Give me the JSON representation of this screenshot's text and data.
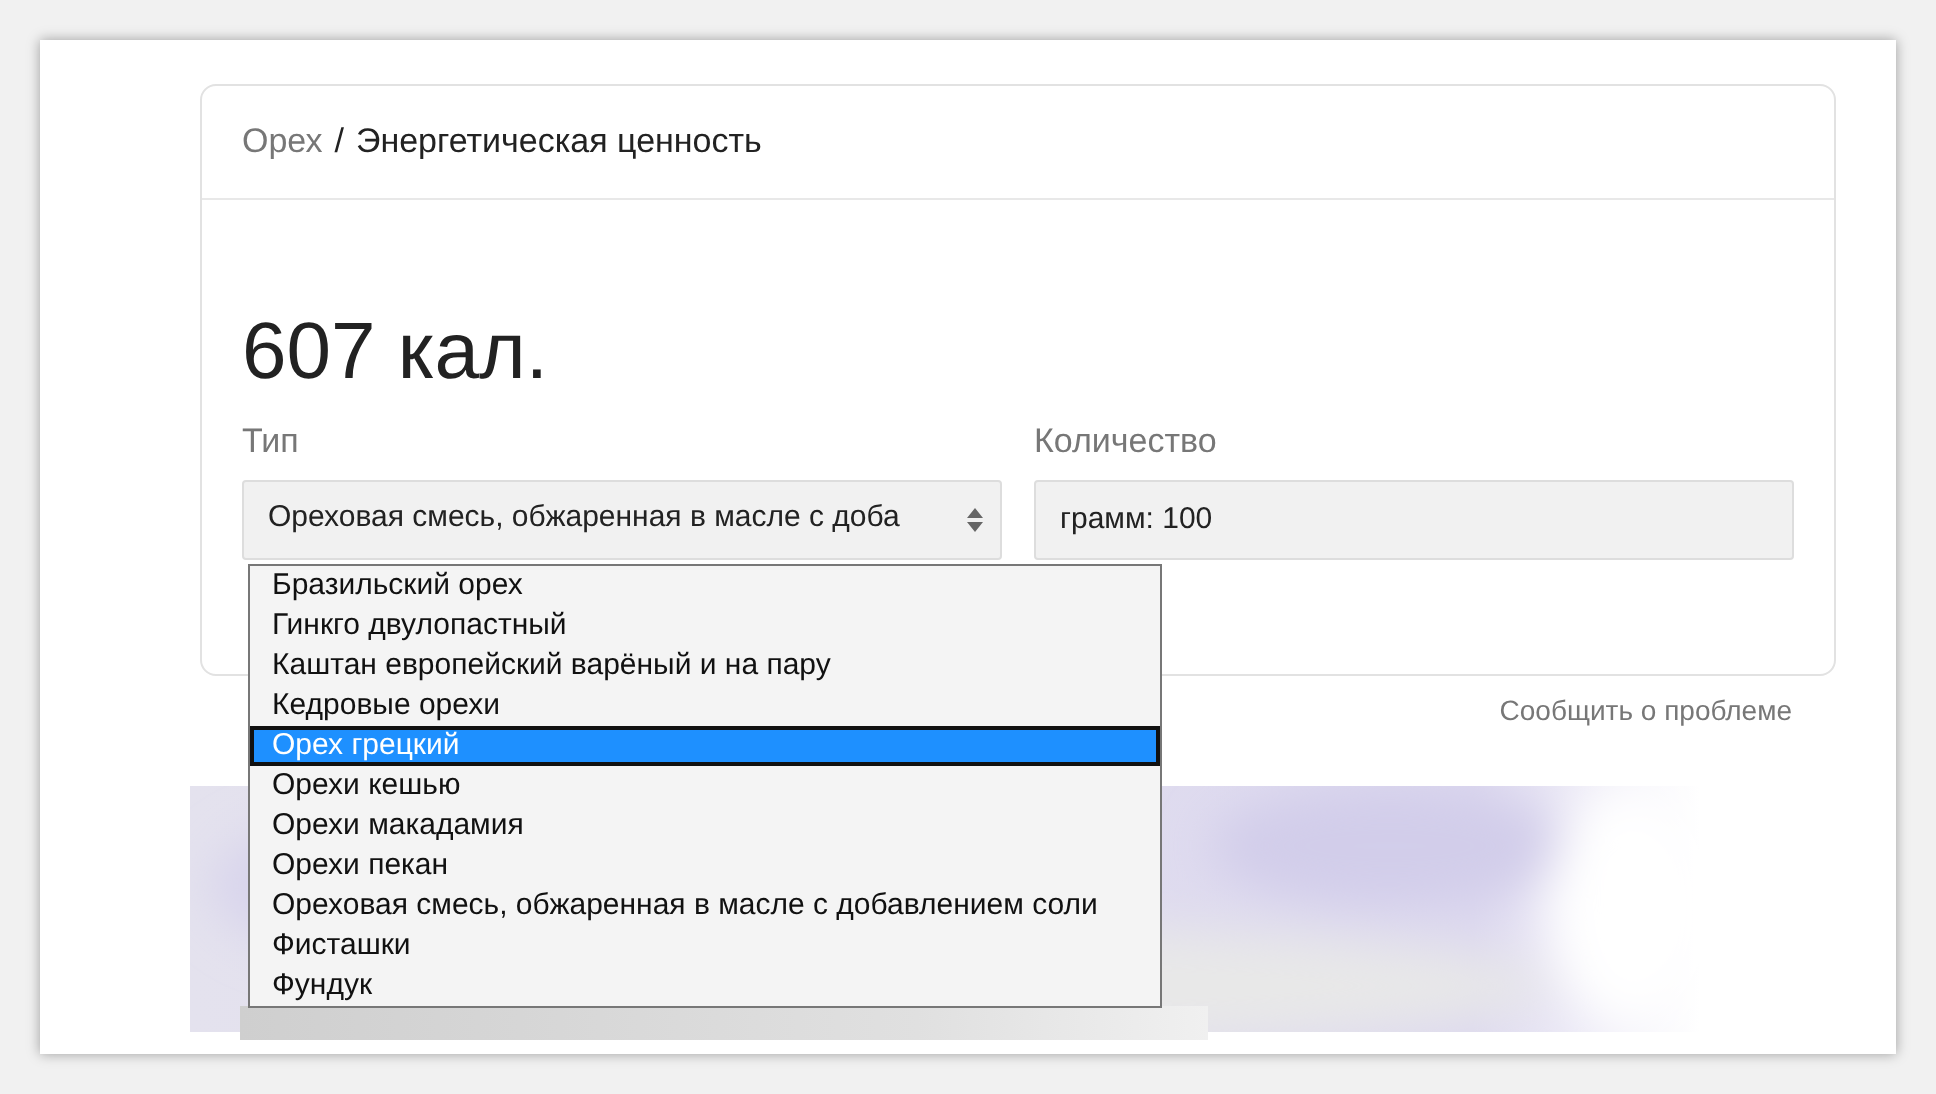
{
  "breadcrumb": {
    "separator": "/",
    "items": [
      {
        "label": "Орех",
        "kind": "link"
      },
      {
        "label": "Энергетическая ценность",
        "kind": "current"
      }
    ]
  },
  "result": "607 кал.",
  "type_field": {
    "label": "Тип",
    "value": "Ореховая смесь, обжаренная в масле с доба"
  },
  "amount_field": {
    "label": "Количество",
    "value": "грамм: 100"
  },
  "dropdown": {
    "options": [
      {
        "label": "Бразильский орех",
        "selected": false
      },
      {
        "label": "Гинкго двулопастный",
        "selected": false
      },
      {
        "label": "Каштан европейский варёный и на пару",
        "selected": false
      },
      {
        "label": "Кедровые орехи",
        "selected": false
      },
      {
        "label": "Орех грецкий",
        "selected": true
      },
      {
        "label": "Орехи кешью",
        "selected": false
      },
      {
        "label": "Орехи макадамия",
        "selected": false
      },
      {
        "label": "Орехи пекан",
        "selected": false
      },
      {
        "label": "Ореховая смесь, обжаренная в масле с добавлением соли",
        "selected": false
      },
      {
        "label": "Фисташки",
        "selected": false
      },
      {
        "label": "Фундук",
        "selected": false
      }
    ]
  },
  "report_link": "Сообщить о проблеме"
}
